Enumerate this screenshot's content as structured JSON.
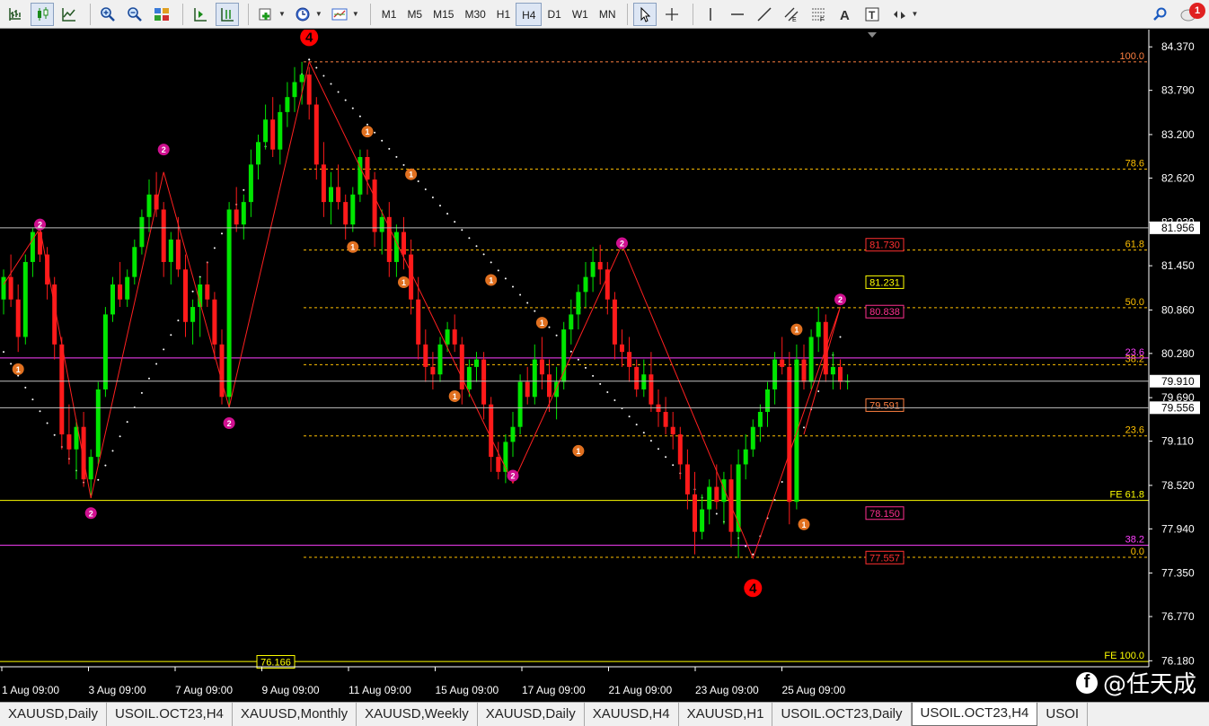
{
  "toolbar": {
    "timeframes": [
      "M1",
      "M5",
      "M15",
      "M30",
      "H1",
      "H4",
      "D1",
      "W1",
      "MN"
    ],
    "active_timeframe": "H4",
    "notification_count": "1"
  },
  "chart_data": {
    "type": "candlestick",
    "symbol_period": "USOIL.OCT23,H4",
    "price_axis": {
      "min": 76.1,
      "max": 84.6,
      "ticks": [
        "84.370",
        "83.790",
        "83.200",
        "82.620",
        "82.030",
        "81.450",
        "80.860",
        "80.280",
        "79.690",
        "79.110",
        "78.520",
        "77.940",
        "77.350",
        "76.770",
        "76.180"
      ]
    },
    "time_axis": [
      "1 Aug 09:00",
      "3 Aug 09:00",
      "7 Aug 09:00",
      "9 Aug 09:00",
      "11 Aug 09:00",
      "15 Aug 09:00",
      "17 Aug 09:00",
      "21 Aug 09:00",
      "23 Aug 09:00",
      "25 Aug 09:00"
    ],
    "price_labels": [
      {
        "text": "81.956",
        "price": 81.956,
        "style": "white"
      },
      {
        "text": "79.910",
        "price": 79.91,
        "style": "white"
      },
      {
        "text": "79.556",
        "price": 79.556,
        "style": "white"
      }
    ],
    "marker_labels": [
      {
        "text": "81.730",
        "price": 81.73,
        "color": "#ff3030"
      },
      {
        "text": "81.231",
        "price": 81.231,
        "color": "#ffff00"
      },
      {
        "text": "80.838",
        "price": 80.838,
        "color": "#ff3090"
      },
      {
        "text": "79.591",
        "price": 79.591,
        "color": "#ff8040"
      },
      {
        "text": "78.150",
        "price": 78.15,
        "color": "#ff3090"
      },
      {
        "text": "77.557",
        "price": 77.557,
        "color": "#ff3030"
      },
      {
        "text": "76.166",
        "price": 76.166,
        "color": "#ffff00"
      }
    ],
    "fib_levels": [
      {
        "label": "100.0",
        "price": 84.17,
        "color": "#ff8040",
        "dash": true
      },
      {
        "label": "78.6",
        "price": 82.74,
        "color": "#ffc000",
        "dash": true
      },
      {
        "label": "61.8",
        "price": 81.66,
        "color": "#ffc000",
        "dash": true
      },
      {
        "label": "50.0",
        "price": 80.89,
        "color": "#ffc000",
        "dash": true
      },
      {
        "label": "38.2",
        "price": 80.13,
        "color": "#ffc000",
        "dash": true
      },
      {
        "label": "23.6",
        "price": 79.18,
        "color": "#ffc000",
        "dash": true
      },
      {
        "label": "0.0",
        "price": 77.56,
        "color": "#ffc000",
        "dash": true
      },
      {
        "label": "23.6",
        "price": 80.22,
        "color": "#ff40ff",
        "dash": false
      },
      {
        "label": "38.2",
        "price": 77.72,
        "color": "#ff40ff",
        "dash": false
      },
      {
        "label": "FE 61.8",
        "price": 78.32,
        "color": "#ffff00",
        "dash": false
      },
      {
        "label": "FE 100.0",
        "price": 76.17,
        "color": "#ffff00",
        "dash": false
      }
    ],
    "wave_labels": [
      {
        "text": "4",
        "color": "#ff0000",
        "date_index": 42,
        "price": 84.5,
        "big": true
      },
      {
        "text": "4",
        "color": "#ff0000",
        "date_index": 103,
        "price": 77.15,
        "big": true
      },
      {
        "text": "2",
        "color": "#d01090",
        "date_index": 5,
        "price": 82.0
      },
      {
        "text": "2",
        "color": "#d01090",
        "date_index": 22,
        "price": 83.0
      },
      {
        "text": "2",
        "color": "#d01090",
        "date_index": 12,
        "price": 78.15
      },
      {
        "text": "2",
        "color": "#d01090",
        "date_index": 31,
        "price": 79.35
      },
      {
        "text": "2",
        "color": "#d01090",
        "date_index": 70,
        "price": 78.65
      },
      {
        "text": "2",
        "color": "#d01090",
        "date_index": 85,
        "price": 81.75
      },
      {
        "text": "2",
        "color": "#d01090",
        "date_index": 115,
        "price": 81.0
      },
      {
        "text": "1",
        "color": "#e07020",
        "date_index": 2,
        "price": 80.07
      },
      {
        "text": "1",
        "color": "#e07020",
        "date_index": 50,
        "price": 83.24
      },
      {
        "text": "1",
        "color": "#e07020",
        "date_index": 56,
        "price": 82.67
      },
      {
        "text": "1",
        "color": "#e07020",
        "date_index": 48,
        "price": 81.7
      },
      {
        "text": "1",
        "color": "#e07020",
        "date_index": 55,
        "price": 81.23
      },
      {
        "text": "1",
        "color": "#e07020",
        "date_index": 67,
        "price": 81.26
      },
      {
        "text": "1",
        "color": "#e07020",
        "date_index": 74,
        "price": 80.69
      },
      {
        "text": "1",
        "color": "#e07020",
        "date_index": 62,
        "price": 79.71
      },
      {
        "text": "1",
        "color": "#e07020",
        "date_index": 79,
        "price": 78.98
      },
      {
        "text": "1",
        "color": "#e07020",
        "date_index": 109,
        "price": 80.6
      },
      {
        "text": "1",
        "color": "#e07020",
        "date_index": 110,
        "price": 78.0
      }
    ],
    "zigzag": [
      [
        0,
        81.2
      ],
      [
        5,
        81.95
      ],
      [
        12,
        78.35
      ],
      [
        22,
        82.7
      ],
      [
        31,
        79.56
      ],
      [
        42,
        84.17
      ],
      [
        70,
        78.55
      ],
      [
        85,
        81.73
      ],
      [
        103,
        77.55
      ],
      [
        115,
        80.9
      ],
      [
        110,
        79.2
      ]
    ],
    "sar_dotted": [
      [
        0,
        80.3
      ],
      [
        12,
        78.4
      ],
      [
        42,
        84.2
      ],
      [
        103,
        77.6
      ],
      [
        115,
        80.5
      ]
    ],
    "candles": [
      [
        81.0,
        81.4,
        80.8,
        81.3
      ],
      [
        81.3,
        81.6,
        80.9,
        81.0
      ],
      [
        81.0,
        81.2,
        80.3,
        80.5
      ],
      [
        80.5,
        81.6,
        80.4,
        81.5
      ],
      [
        81.5,
        81.95,
        81.3,
        81.9
      ],
      [
        81.9,
        82.0,
        81.5,
        81.6
      ],
      [
        81.6,
        81.7,
        81.0,
        81.2
      ],
      [
        81.2,
        81.3,
        80.2,
        80.4
      ],
      [
        80.4,
        80.5,
        79.0,
        79.2
      ],
      [
        79.2,
        79.6,
        78.8,
        79.0
      ],
      [
        79.0,
        79.4,
        78.6,
        79.3
      ],
      [
        79.3,
        79.5,
        78.5,
        78.6
      ],
      [
        78.6,
        79.0,
        78.35,
        78.9
      ],
      [
        78.9,
        79.9,
        78.8,
        79.8
      ],
      [
        79.8,
        80.9,
        79.7,
        80.8
      ],
      [
        80.8,
        81.3,
        80.7,
        81.2
      ],
      [
        81.2,
        81.5,
        80.9,
        81.0
      ],
      [
        81.0,
        81.4,
        80.9,
        81.3
      ],
      [
        81.3,
        81.8,
        81.2,
        81.7
      ],
      [
        81.7,
        82.2,
        81.6,
        82.1
      ],
      [
        82.1,
        82.6,
        81.9,
        82.4
      ],
      [
        82.4,
        82.7,
        82.1,
        82.2
      ],
      [
        82.2,
        82.3,
        81.3,
        81.5
      ],
      [
        81.5,
        81.9,
        81.2,
        81.8
      ],
      [
        81.8,
        82.1,
        81.3,
        81.4
      ],
      [
        81.4,
        81.6,
        80.5,
        80.7
      ],
      [
        80.7,
        81.0,
        80.4,
        80.9
      ],
      [
        80.9,
        81.3,
        80.5,
        81.2
      ],
      [
        81.2,
        81.5,
        80.9,
        81.0
      ],
      [
        81.0,
        81.1,
        80.2,
        80.4
      ],
      [
        80.4,
        80.6,
        79.6,
        79.7
      ],
      [
        79.7,
        82.3,
        79.56,
        82.2
      ],
      [
        82.2,
        82.5,
        81.9,
        82.0
      ],
      [
        82.0,
        82.4,
        81.8,
        82.3
      ],
      [
        82.3,
        83.0,
        82.1,
        82.8
      ],
      [
        82.8,
        83.2,
        82.6,
        83.1
      ],
      [
        83.1,
        83.6,
        83.0,
        83.4
      ],
      [
        83.4,
        83.7,
        82.9,
        83.0
      ],
      [
        83.0,
        83.6,
        82.8,
        83.5
      ],
      [
        83.5,
        83.9,
        83.3,
        83.7
      ],
      [
        83.7,
        84.1,
        83.5,
        83.9
      ],
      [
        83.9,
        84.17,
        83.6,
        84.0
      ],
      [
        84.0,
        84.1,
        83.4,
        83.6
      ],
      [
        83.6,
        83.7,
        82.6,
        82.8
      ],
      [
        82.8,
        83.1,
        82.1,
        82.3
      ],
      [
        82.3,
        82.7,
        82.0,
        82.5
      ],
      [
        82.5,
        82.8,
        82.2,
        82.3
      ],
      [
        82.3,
        82.4,
        81.8,
        82.0
      ],
      [
        82.0,
        82.5,
        81.9,
        82.4
      ],
      [
        82.4,
        83.0,
        82.3,
        82.9
      ],
      [
        82.9,
        83.0,
        82.4,
        82.6
      ],
      [
        82.6,
        82.7,
        81.7,
        81.9
      ],
      [
        81.9,
        82.2,
        81.6,
        82.1
      ],
      [
        82.1,
        82.3,
        81.3,
        81.5
      ],
      [
        81.5,
        82.0,
        81.3,
        81.9
      ],
      [
        81.9,
        82.1,
        81.4,
        81.6
      ],
      [
        81.6,
        81.8,
        80.8,
        81.0
      ],
      [
        81.0,
        81.3,
        80.2,
        80.4
      ],
      [
        80.4,
        80.6,
        79.9,
        80.1
      ],
      [
        80.1,
        80.3,
        79.8,
        80.0
      ],
      [
        80.0,
        80.5,
        79.9,
        80.4
      ],
      [
        80.4,
        80.7,
        80.3,
        80.6
      ],
      [
        80.6,
        80.8,
        80.3,
        80.4
      ],
      [
        80.4,
        80.5,
        79.6,
        79.8
      ],
      [
        79.8,
        80.2,
        79.7,
        80.1
      ],
      [
        80.1,
        80.3,
        79.9,
        80.2
      ],
      [
        80.2,
        80.3,
        79.4,
        79.6
      ],
      [
        79.6,
        79.7,
        78.7,
        78.9
      ],
      [
        78.9,
        79.1,
        78.6,
        78.7
      ],
      [
        78.7,
        79.2,
        78.55,
        79.1
      ],
      [
        79.1,
        79.5,
        78.9,
        79.3
      ],
      [
        79.3,
        80.0,
        79.2,
        79.9
      ],
      [
        79.9,
        80.1,
        79.6,
        79.7
      ],
      [
        79.7,
        80.4,
        79.6,
        80.2
      ],
      [
        80.2,
        80.5,
        79.8,
        80.0
      ],
      [
        80.0,
        80.2,
        79.5,
        79.7
      ],
      [
        79.7,
        80.1,
        79.4,
        79.9
      ],
      [
        79.9,
        80.7,
        79.8,
        80.6
      ],
      [
        80.6,
        81.0,
        80.4,
        80.8
      ],
      [
        80.8,
        81.2,
        80.6,
        81.1
      ],
      [
        81.1,
        81.5,
        80.9,
        81.3
      ],
      [
        81.3,
        81.7,
        81.1,
        81.5
      ],
      [
        81.5,
        81.73,
        81.2,
        81.4
      ],
      [
        81.4,
        81.5,
        80.8,
        81.0
      ],
      [
        81.0,
        81.1,
        80.2,
        80.4
      ],
      [
        80.4,
        80.6,
        80.1,
        80.3
      ],
      [
        80.3,
        80.5,
        79.9,
        80.1
      ],
      [
        80.1,
        80.2,
        79.7,
        79.8
      ],
      [
        79.8,
        80.2,
        79.7,
        80.0
      ],
      [
        80.0,
        80.3,
        79.5,
        79.6
      ],
      [
        79.6,
        79.8,
        79.3,
        79.5
      ],
      [
        79.5,
        79.7,
        79.2,
        79.3
      ],
      [
        79.3,
        79.5,
        79.0,
        79.2
      ],
      [
        79.2,
        79.3,
        78.6,
        78.8
      ],
      [
        78.8,
        79.0,
        78.2,
        78.4
      ],
      [
        78.4,
        78.7,
        77.6,
        77.9
      ],
      [
        77.9,
        78.4,
        77.8,
        78.2
      ],
      [
        78.2,
        78.6,
        78.0,
        78.5
      ],
      [
        78.5,
        78.8,
        78.2,
        78.3
      ],
      [
        78.3,
        78.7,
        78.0,
        78.6
      ],
      [
        78.6,
        78.8,
        77.7,
        77.9
      ],
      [
        77.9,
        79.0,
        77.55,
        78.8
      ],
      [
        78.8,
        79.2,
        78.6,
        79.0
      ],
      [
        79.0,
        79.4,
        78.9,
        79.3
      ],
      [
        79.3,
        79.6,
        79.1,
        79.5
      ],
      [
        79.5,
        79.9,
        79.3,
        79.8
      ],
      [
        79.8,
        80.3,
        79.6,
        80.2
      ],
      [
        80.2,
        80.5,
        80.0,
        80.1
      ],
      [
        80.1,
        80.3,
        78.0,
        78.3
      ],
      [
        78.3,
        80.4,
        78.2,
        80.2
      ],
      [
        80.2,
        80.4,
        79.8,
        79.9
      ],
      [
        79.9,
        80.6,
        79.8,
        80.5
      ],
      [
        80.5,
        80.9,
        80.3,
        80.7
      ],
      [
        80.7,
        80.8,
        79.9,
        80.0
      ],
      [
        80.0,
        80.3,
        79.8,
        80.1
      ],
      [
        80.1,
        80.2,
        79.8,
        79.9
      ],
      [
        79.9,
        80.0,
        79.8,
        79.91
      ]
    ],
    "bull_color": "#00e600",
    "bear_color": "#ff1a1a",
    "grid": false
  },
  "tabs": [
    {
      "label": "XAUUSD,Daily",
      "active": false
    },
    {
      "label": "USOIL.OCT23,H4",
      "active": false
    },
    {
      "label": "XAUUSD,Monthly",
      "active": false
    },
    {
      "label": "XAUUSD,Weekly",
      "active": false
    },
    {
      "label": "XAUUSD,Daily",
      "active": false
    },
    {
      "label": "XAUUSD,H4",
      "active": false
    },
    {
      "label": "XAUUSD,H1",
      "active": false
    },
    {
      "label": "USOIL.OCT23,Daily",
      "active": false
    },
    {
      "label": "USOIL.OCT23,H4",
      "active": true
    },
    {
      "label": "USOI",
      "active": false
    }
  ],
  "watermark": {
    "handle": "@任天成",
    "icon_letter": "f"
  }
}
